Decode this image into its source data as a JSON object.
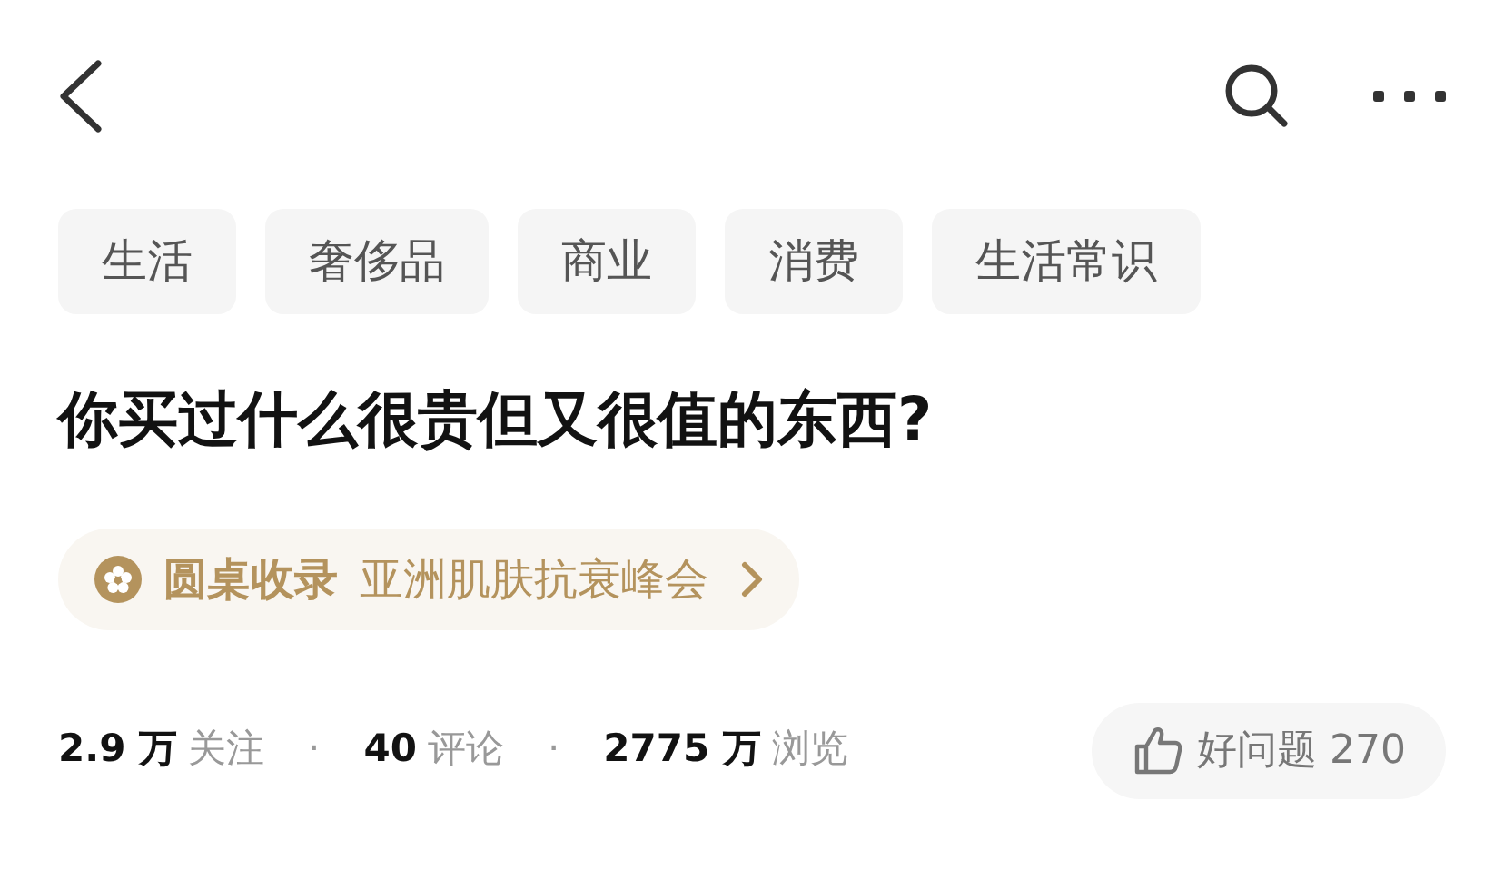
{
  "tags": [
    "生活",
    "奢侈品",
    "商业",
    "消费",
    "生活常识"
  ],
  "question": {
    "title": "你买过什么很贵但又很值的东西?"
  },
  "roundtable": {
    "label": "圆桌收录",
    "name": "亚洲肌肤抗衰峰会"
  },
  "stats": [
    {
      "value": "2.9 万",
      "label": "关注"
    },
    {
      "value": "40",
      "label": "评论"
    },
    {
      "value": "2775 万",
      "label": "浏览"
    }
  ],
  "separators": [
    "·",
    "·"
  ],
  "good_question": {
    "label": "好问题",
    "count": "270"
  }
}
